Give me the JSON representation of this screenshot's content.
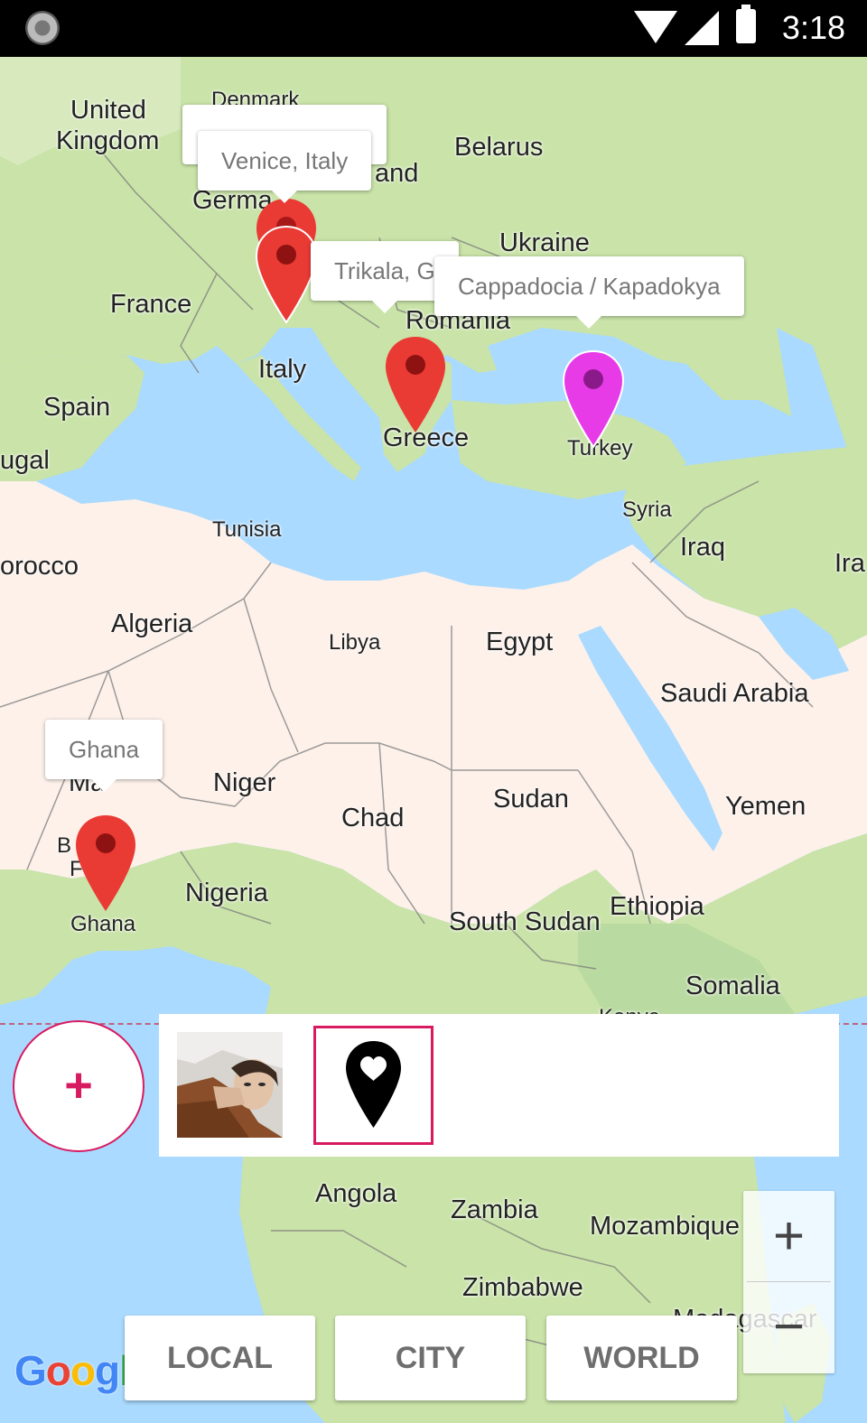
{
  "status_bar": {
    "time": "3:18"
  },
  "map": {
    "countries": {
      "united_kingdom_1": "United",
      "united_kingdom_2": "Kingdom",
      "denmark": "Denmark",
      "belarus": "Belarus",
      "germany": "Germa",
      "poland": "and",
      "ukraine": "Ukraine",
      "france": "France",
      "romania": "Romania",
      "italy": "Italy",
      "spain": "Spain",
      "portugal": "ugal",
      "greece": "Greece",
      "turkey": "Turkey",
      "tunisia": "Tunisia",
      "syria": "Syria",
      "morocco": "orocco",
      "iraq": "Iraq",
      "iran": "Ira",
      "algeria": "Algeria",
      "libya": "Libya",
      "egypt": "Egypt",
      "saudi_arabia": "Saudi Arabia",
      "mali": "Ma",
      "niger": "Niger",
      "chad": "Chad",
      "sudan": "Sudan",
      "yemen": "Yemen",
      "burkina_1": "B",
      "burkina_2": "F",
      "ghana": "Ghana",
      "nigeria": "Nigeria",
      "south_sudan": "South Sudan",
      "ethiopia": "Ethiopia",
      "somalia": "Somalia",
      "kenya": "Kenya",
      "angola": "Angola",
      "zambia": "Zambia",
      "mozambique": "Mozambique",
      "zimbabwe": "Zimbabwe",
      "madagascar": "Madagascar"
    },
    "info_windows": {
      "venice": "Venice, Italy",
      "trikala": "Trikala, G",
      "cappadocia": "Cappadocia / Kapadokya",
      "ghana": "Ghana"
    },
    "colors": {
      "water": "#aadaff",
      "land_europe": "#c9e3a8",
      "land_africa": "#fdf1ea",
      "pin_red": "#ea3a34",
      "pin_magenta": "#e83be8",
      "accent": "#d81b60"
    }
  },
  "add_button": {
    "label": "+"
  },
  "zoom": {
    "in": "+",
    "out": "−"
  },
  "logo": "Google",
  "tabs": {
    "local": "LOCAL",
    "city": "CITY",
    "world": "WORLD"
  }
}
